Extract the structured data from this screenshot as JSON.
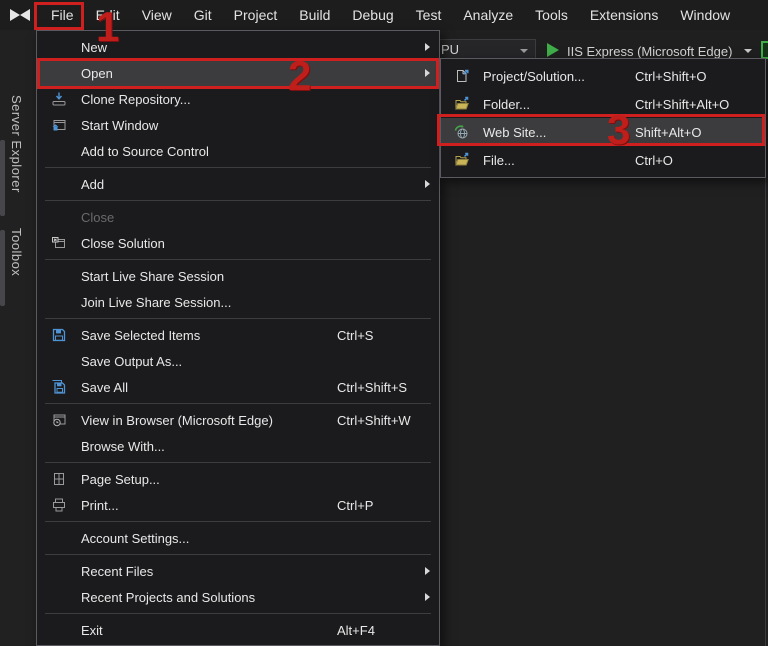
{
  "app": {
    "name": "Visual Studio"
  },
  "colors": {
    "annotation_red": "#d01f1f",
    "accent_blue": "#4f94d4",
    "run_green": "#3fae49",
    "popup_bg": "#1b1b1d",
    "highlight_bg": "#3c3c3e"
  },
  "menubar": {
    "items": [
      {
        "label": "File"
      },
      {
        "label": "Edit"
      },
      {
        "label": "View"
      },
      {
        "label": "Git"
      },
      {
        "label": "Project"
      },
      {
        "label": "Build"
      },
      {
        "label": "Debug"
      },
      {
        "label": "Test"
      },
      {
        "label": "Analyze"
      },
      {
        "label": "Tools"
      },
      {
        "label": "Extensions"
      },
      {
        "label": "Window"
      }
    ]
  },
  "toolbar": {
    "combo_value": "PU",
    "run_target": "IIS Express (Microsoft Edge)"
  },
  "sidebar": {
    "tabs": [
      {
        "label": "Server Explorer"
      },
      {
        "label": "Toolbox"
      }
    ]
  },
  "file_menu": {
    "items": [
      {
        "label": "New",
        "shortcut": ""
      },
      {
        "label": "Open",
        "shortcut": ""
      },
      {
        "label": "Clone Repository...",
        "shortcut": ""
      },
      {
        "label": "Start Window",
        "shortcut": ""
      },
      {
        "label": "Add to Source Control",
        "shortcut": ""
      },
      {
        "label": "Add",
        "shortcut": ""
      },
      {
        "label": "Close",
        "shortcut": ""
      },
      {
        "label": "Close Solution",
        "shortcut": ""
      },
      {
        "label": "Start Live Share Session",
        "shortcut": ""
      },
      {
        "label": "Join Live Share Session...",
        "shortcut": ""
      },
      {
        "label": "Save Selected Items",
        "shortcut": "Ctrl+S"
      },
      {
        "label": "Save Output As...",
        "shortcut": ""
      },
      {
        "label": "Save All",
        "shortcut": "Ctrl+Shift+S"
      },
      {
        "label": "View in Browser (Microsoft Edge)",
        "shortcut": "Ctrl+Shift+W"
      },
      {
        "label": "Browse With...",
        "shortcut": ""
      },
      {
        "label": "Page Setup...",
        "shortcut": ""
      },
      {
        "label": "Print...",
        "shortcut": "Ctrl+P"
      },
      {
        "label": "Account Settings...",
        "shortcut": ""
      },
      {
        "label": "Recent Files",
        "shortcut": ""
      },
      {
        "label": "Recent Projects and Solutions",
        "shortcut": ""
      },
      {
        "label": "Exit",
        "shortcut": "Alt+F4"
      }
    ]
  },
  "open_submenu": {
    "items": [
      {
        "label": "Project/Solution...",
        "shortcut": "Ctrl+Shift+O"
      },
      {
        "label": "Folder...",
        "shortcut": "Ctrl+Shift+Alt+O"
      },
      {
        "label": "Web Site...",
        "shortcut": "Shift+Alt+O"
      },
      {
        "label": "File...",
        "shortcut": "Ctrl+O"
      }
    ]
  },
  "annotations": {
    "step1": "1",
    "step2": "2",
    "step3": "3"
  }
}
